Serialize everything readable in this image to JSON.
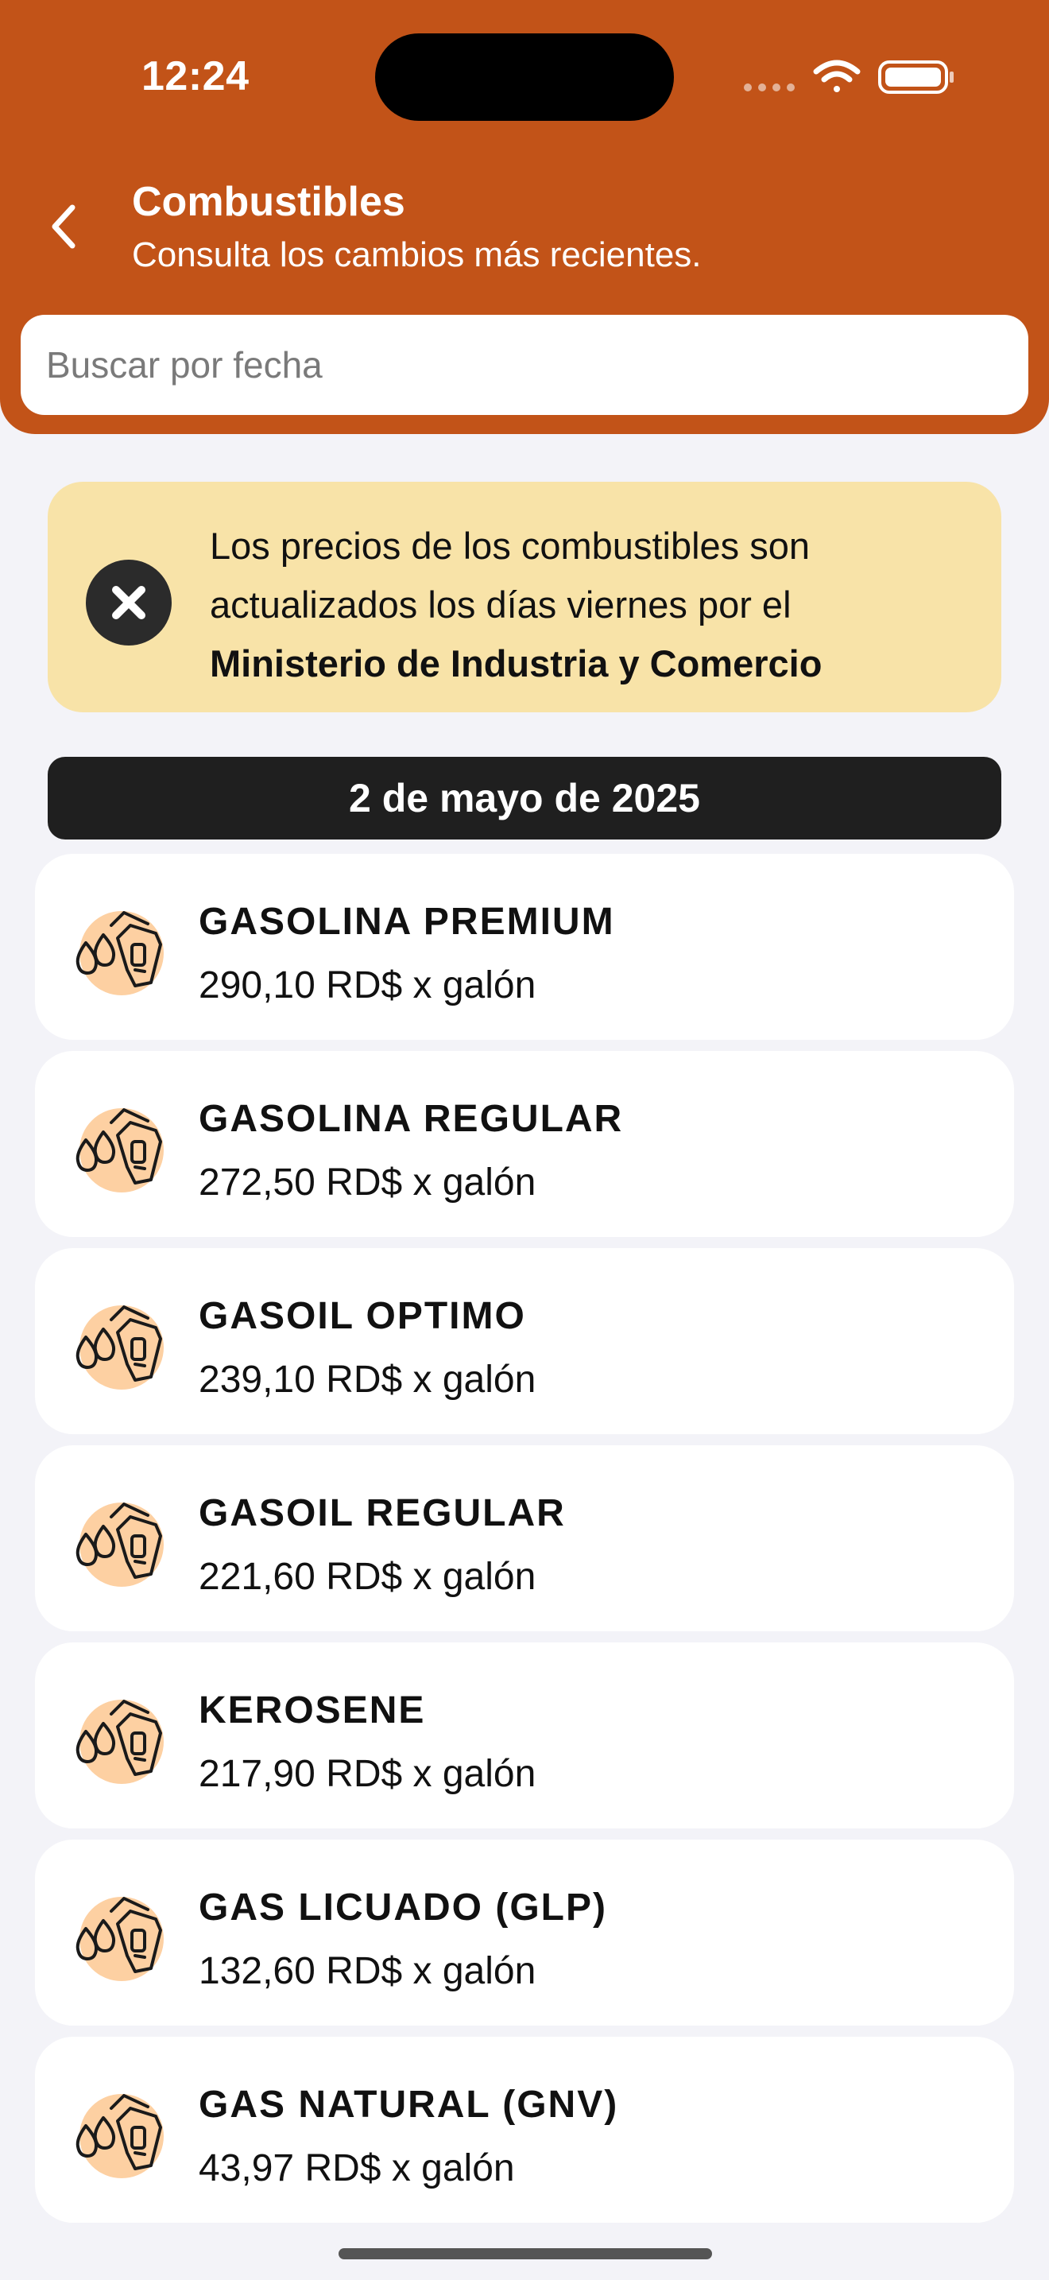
{
  "status_bar": {
    "time": "12:24"
  },
  "header": {
    "title": "Combustibles",
    "subtitle": "Consulta los cambios más recientes."
  },
  "search": {
    "placeholder": "Buscar por fecha",
    "value": ""
  },
  "banner": {
    "text_line1": "Los precios de los combustibles son",
    "text_line2": "actualizados los días viernes por el",
    "text_bold": "Ministerio de Industria y Comercio",
    "icon": "close-circle-icon"
  },
  "date_header": "2 de mayo de 2025",
  "fuels": [
    {
      "name": "GASOLINA PREMIUM",
      "price": "290,10 RD$ x galón"
    },
    {
      "name": "GASOLINA REGULAR",
      "price": "272,50 RD$ x galón"
    },
    {
      "name": "GASOIL OPTIMO",
      "price": "239,10 RD$ x galón"
    },
    {
      "name": "GASOIL REGULAR",
      "price": "221,60 RD$ x galón"
    },
    {
      "name": "KEROSENE",
      "price": "217,90 RD$ x galón"
    },
    {
      "name": "GAS LICUADO (GLP)",
      "price": "132,60 RD$ x galón"
    },
    {
      "name": "GAS NATURAL (GNV)",
      "price": "43,97 RD$ x galón"
    }
  ],
  "colors": {
    "header": "#c25318",
    "banner": "#f8e3a8",
    "date_bar": "#1f1f1f",
    "icon_bg": "#fdd0a2",
    "page_bg": "#f3f3f8"
  },
  "icons": {
    "back": "chevron-left-icon",
    "fuel": "fuel-nozzle-icon",
    "wifi": "wifi-icon",
    "battery": "battery-icon",
    "signal": "signal-icon"
  }
}
